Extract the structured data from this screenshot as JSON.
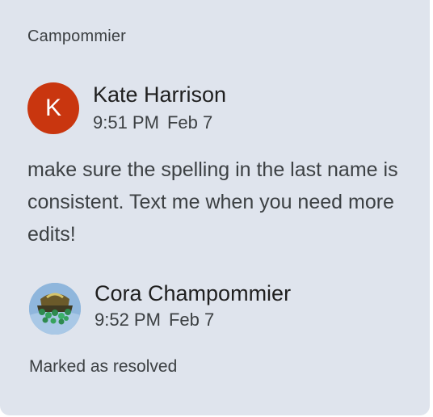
{
  "thread": {
    "context_title": "Campommier",
    "comment": {
      "avatar_letter": "K",
      "author": "Kate Harrison",
      "time": "9:51 PM",
      "date": "Feb 7",
      "text": "make sure the spelling in the last name is consistent. Text me when you need more edits!"
    },
    "reply": {
      "author": "Cora Champommier",
      "time": "9:52 PM",
      "date": "Feb 7",
      "status": "Marked as resolved"
    }
  },
  "colors": {
    "card_background": "#dfe4ed",
    "avatar_k": "#c9360f"
  }
}
